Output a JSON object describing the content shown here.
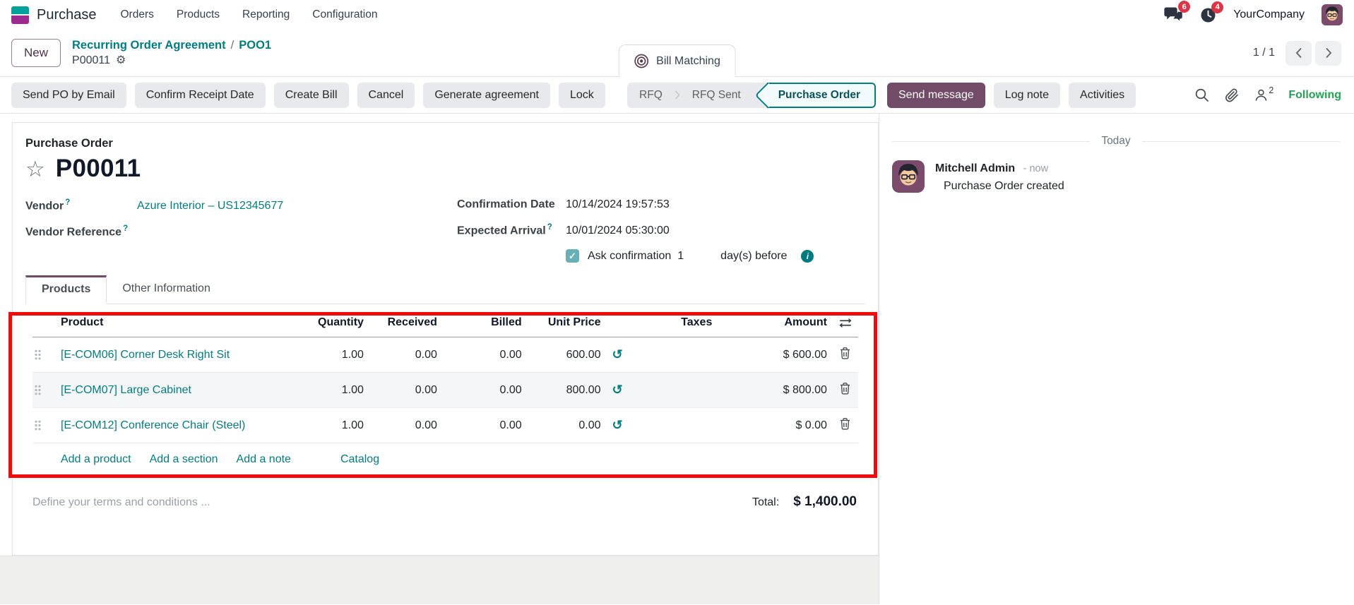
{
  "navbar": {
    "app_name": "Purchase",
    "menu_items": [
      "Orders",
      "Products",
      "Reporting",
      "Configuration"
    ],
    "messages_badge": "6",
    "activities_badge": "4",
    "company": "YourCompany"
  },
  "breadcrumb": {
    "new_button": "New",
    "parent_link": "Recurring Order Agreement",
    "separator": "/",
    "agreement_link": "POO1",
    "record": "P00011",
    "bill_matching": "Bill Matching",
    "pager": "1 / 1"
  },
  "actions": {
    "buttons": [
      "Send PO by Email",
      "Confirm Receipt Date",
      "Create Bill",
      "Cancel",
      "Generate agreement",
      "Lock"
    ],
    "status_steps": [
      {
        "label": "RFQ",
        "state": "done"
      },
      {
        "label": "RFQ Sent",
        "state": "done"
      },
      {
        "label": "Purchase Order",
        "state": "current"
      }
    ],
    "chatter_buttons": [
      "Send message",
      "Log note",
      "Activities"
    ],
    "followers_count": "2",
    "following_label": "Following"
  },
  "form": {
    "doc_type": "Purchase Order",
    "name": "P00011",
    "fields": {
      "vendor_label": "Vendor",
      "vendor_value": "Azure Interior – US12345677",
      "vendor_ref_label": "Vendor Reference",
      "confirmation_date_label": "Confirmation Date",
      "confirmation_date_value": "10/14/2024 19:57:53",
      "expected_arrival_label": "Expected Arrival",
      "expected_arrival_value": "10/01/2024 05:30:00",
      "ask_confirmation_label": "Ask confirmation",
      "ask_confirmation_days": "1",
      "ask_confirmation_suffix": "day(s) before"
    },
    "tabs": [
      "Products",
      "Other Information"
    ],
    "table": {
      "headers": [
        "Product",
        "Quantity",
        "Received",
        "Billed",
        "Unit Price",
        "Taxes",
        "Amount"
      ],
      "rows": [
        {
          "product": "[E-COM06] Corner Desk Right Sit",
          "quantity": "1.00",
          "received": "0.00",
          "billed": "0.00",
          "unit_price": "600.00",
          "taxes": "",
          "amount": "$ 600.00"
        },
        {
          "product": "[E-COM07] Large Cabinet",
          "quantity": "1.00",
          "received": "0.00",
          "billed": "0.00",
          "unit_price": "800.00",
          "taxes": "",
          "amount": "$ 800.00"
        },
        {
          "product": "[E-COM12] Conference Chair (Steel)",
          "quantity": "1.00",
          "received": "0.00",
          "billed": "0.00",
          "unit_price": "0.00",
          "taxes": "",
          "amount": "$ 0.00"
        }
      ],
      "footer_links": [
        "Add a product",
        "Add a section",
        "Add a note",
        "Catalog"
      ]
    },
    "terms_placeholder": "Define your terms and conditions ...",
    "total_label": "Total:",
    "total_value": "$ 1,400.00"
  },
  "chatter": {
    "date_divider": "Today",
    "messages": [
      {
        "author": "Mitchell Admin",
        "time": "- now",
        "body": "Purchase Order created"
      }
    ]
  },
  "icons": {
    "star": "☆",
    "gear": "⚙",
    "history": "↺",
    "check": "✓",
    "info": "i"
  },
  "colors": {
    "primary": "#714B67",
    "link_teal": "#017E84",
    "following_green": "#21a353",
    "notification_badge": "#dc3545",
    "highlight_red": "#f30b0b",
    "status_active_bg": "#f2fafa",
    "muted_button_bg": "#e7e9ed",
    "logo_teal": "#00a09b",
    "logo_magenta": "#9d2b8f",
    "checkbox_teal": "#65b1b6"
  }
}
